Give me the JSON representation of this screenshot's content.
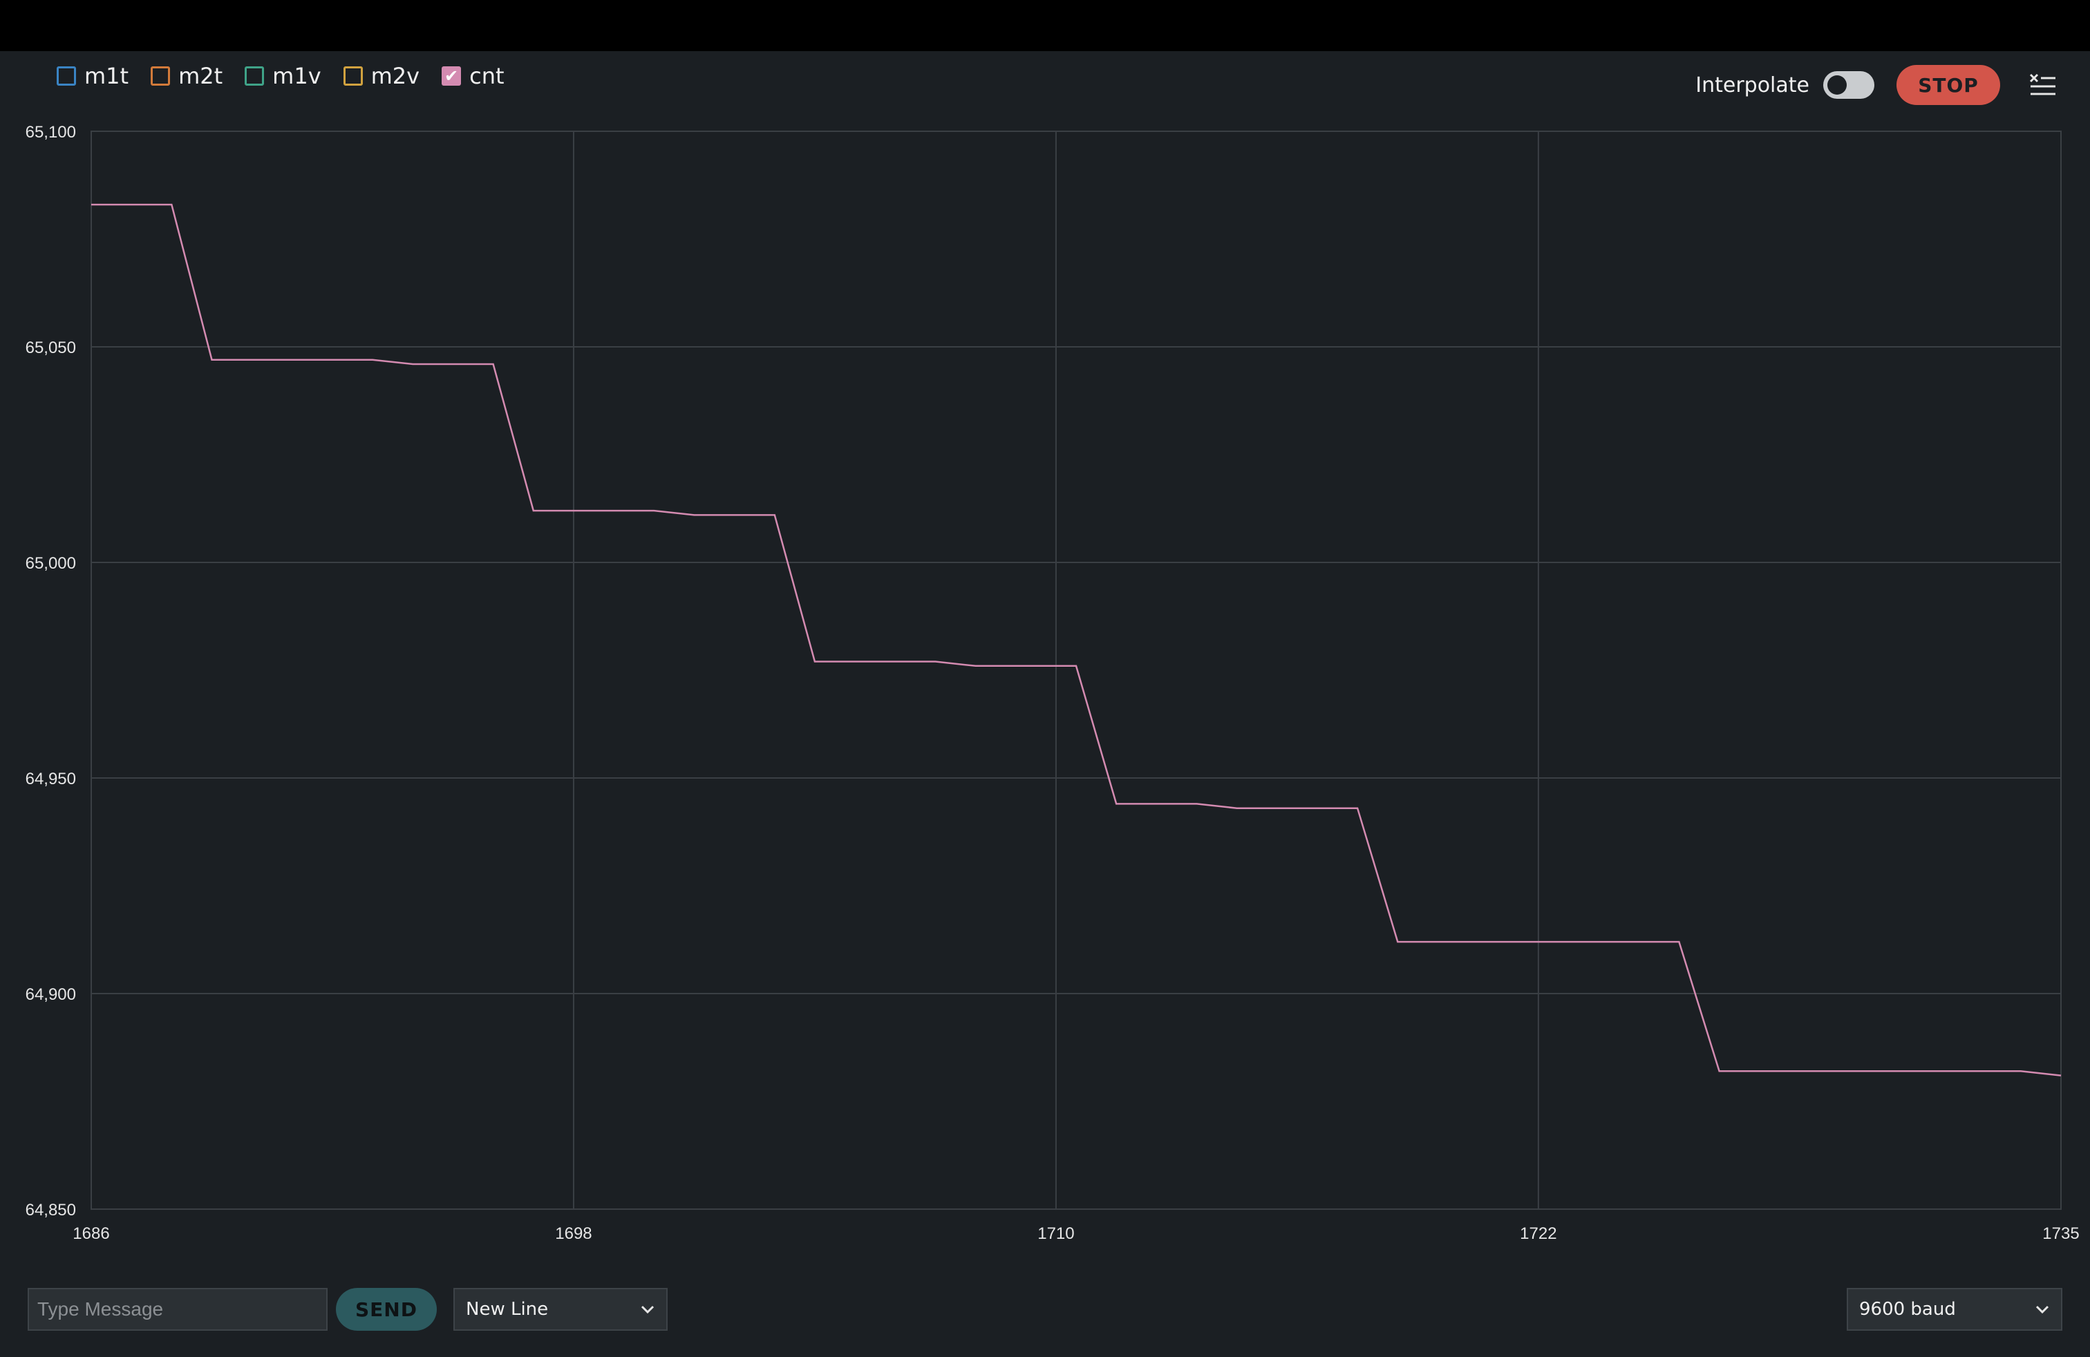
{
  "legend": [
    {
      "label": "m1t",
      "color": "#3a84c4",
      "checked": false
    },
    {
      "label": "m2t",
      "color": "#d27a3a",
      "checked": false
    },
    {
      "label": "m1v",
      "color": "#3fa388",
      "checked": false
    },
    {
      "label": "m2v",
      "color": "#d1a23f",
      "checked": false
    },
    {
      "label": "cnt",
      "color": "#d48bb1",
      "checked": true
    }
  ],
  "controls": {
    "interpolate_label": "Interpolate",
    "interpolate_on": false,
    "stop_label": "STOP",
    "menu_icon": "clear-list-icon"
  },
  "bottom": {
    "message_placeholder": "Type Message",
    "send_label": "SEND",
    "line_ending": "New Line",
    "baud": "9600 baud"
  },
  "chart_data": {
    "type": "line",
    "xlim": [
      1686,
      1735
    ],
    "ylim": [
      64850,
      65100
    ],
    "x_ticks": [
      "1686",
      "1698",
      "1710",
      "1722",
      "1735"
    ],
    "y_ticks": [
      "65,100",
      "65,050",
      "65,000",
      "64,950",
      "64,900",
      "64,850"
    ],
    "grid": true,
    "series": [
      {
        "name": "cnt",
        "color": "#d48bb1",
        "x": [
          1686,
          1688,
          1689,
          1693,
          1694,
          1696,
          1697,
          1700,
          1701,
          1703,
          1704,
          1707,
          1708,
          1710.5,
          1711.5,
          1713.5,
          1714.5,
          1717.5,
          1718.5,
          1725.5,
          1726.5,
          1734,
          1735
        ],
        "y": [
          65083,
          65083,
          65047,
          65047,
          65046,
          65046,
          65012,
          65012,
          65011,
          65011,
          64977,
          64977,
          64976,
          64976,
          64944,
          64944,
          64943,
          64943,
          64912,
          64912,
          64882,
          64882,
          64881
        ]
      }
    ]
  }
}
